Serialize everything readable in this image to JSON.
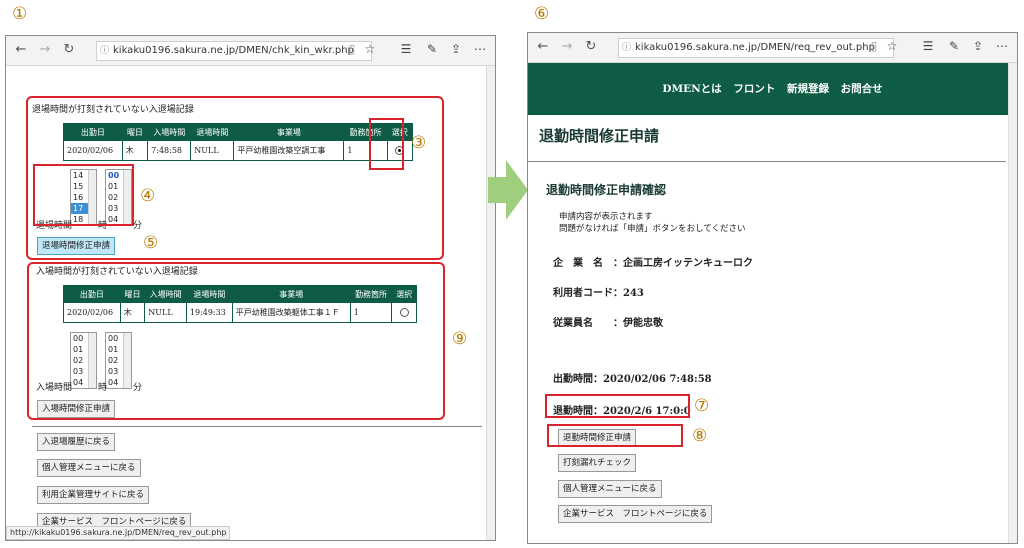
{
  "markers": {
    "m1": "①",
    "m2": "②",
    "m3": "③",
    "m4": "④",
    "m5": "⑤",
    "m6": "⑥",
    "m7": "⑦",
    "m8": "⑧",
    "m9": "⑨"
  },
  "left_window": {
    "url": "kikaku0196.sakura.ne.jp/DMEN/chk_kin_wkr.php",
    "exit_section": {
      "title": "退場時間が打刻されていない入退場記録",
      "headers": [
        "出勤日",
        "曜日",
        "入場時間",
        "退場時間",
        "事業場",
        "勤務箇所",
        "選択"
      ],
      "row": [
        "2020/02/06",
        "木",
        "7:48:58",
        "NULL",
        "平戸幼稚園改築空調工事",
        "1"
      ],
      "hour_options": [
        "14",
        "15",
        "16",
        "17",
        "18"
      ],
      "minute_options": [
        "00",
        "01",
        "02",
        "03",
        "04"
      ],
      "time_label": "退場時間",
      "hour_unit": "時",
      "minute_unit": "分",
      "button": "退場時間修正申請"
    },
    "entry_section": {
      "title": "入場時間が打刻されていない入退場記録",
      "headers": [
        "出勤日",
        "曜日",
        "入場時間",
        "退場時間",
        "事業場",
        "勤務箇所",
        "選択"
      ],
      "row": [
        "2020/02/06",
        "木",
        "NULL",
        "19:49:33",
        "平戸幼稚園改築躯体工事１Ｆ",
        "1"
      ],
      "hour_options": [
        "00",
        "01",
        "02",
        "03",
        "04"
      ],
      "minute_options": [
        "00",
        "01",
        "02",
        "03",
        "04"
      ],
      "time_label": "入場時間",
      "hour_unit": "時",
      "minute_unit": "分",
      "button": "入場時間修正申請"
    },
    "nav_buttons": [
      "入退場履歴に戻る",
      "個人管理メニューに戻る",
      "利用企業管理サイトに戻る",
      "企業サービス　フロントページに戻る"
    ],
    "status_url": "http://kikaku0196.sakura.ne.jp/DMEN/req_rev_out.php"
  },
  "right_window": {
    "url": "kikaku0196.sakura.ne.jp/DMEN/req_rev_out.php",
    "nav": [
      "DMENとは",
      "フロント",
      "新規登録",
      "お問合せ"
    ],
    "page_title": "退勤時間修正申請",
    "section_title": "退勤時間修正申請確認",
    "instruction_1": "申請内容が表示されます",
    "instruction_2": "問題がなければ「申請」ボタンをおしてください",
    "company": "企　業　名　：企画工房イッテンキューロク",
    "user_code": "利用者コード：243",
    "employee": "従業員名　　：伊能忠敬",
    "clock_in": "出勤時間：2020/02/06 7:48:58",
    "clock_out": "退勤時間：2020/2/6 17:0:0",
    "buttons": [
      "退勤時間修正申請",
      "打刻漏れチェック",
      "個人管理メニューに戻る",
      "企業サービス　フロントページに戻る"
    ]
  },
  "colors": {
    "accent": "#0e5c45",
    "highlight": "#d9242d",
    "marker": "#b87900",
    "arrow": "#9fcf7e"
  }
}
